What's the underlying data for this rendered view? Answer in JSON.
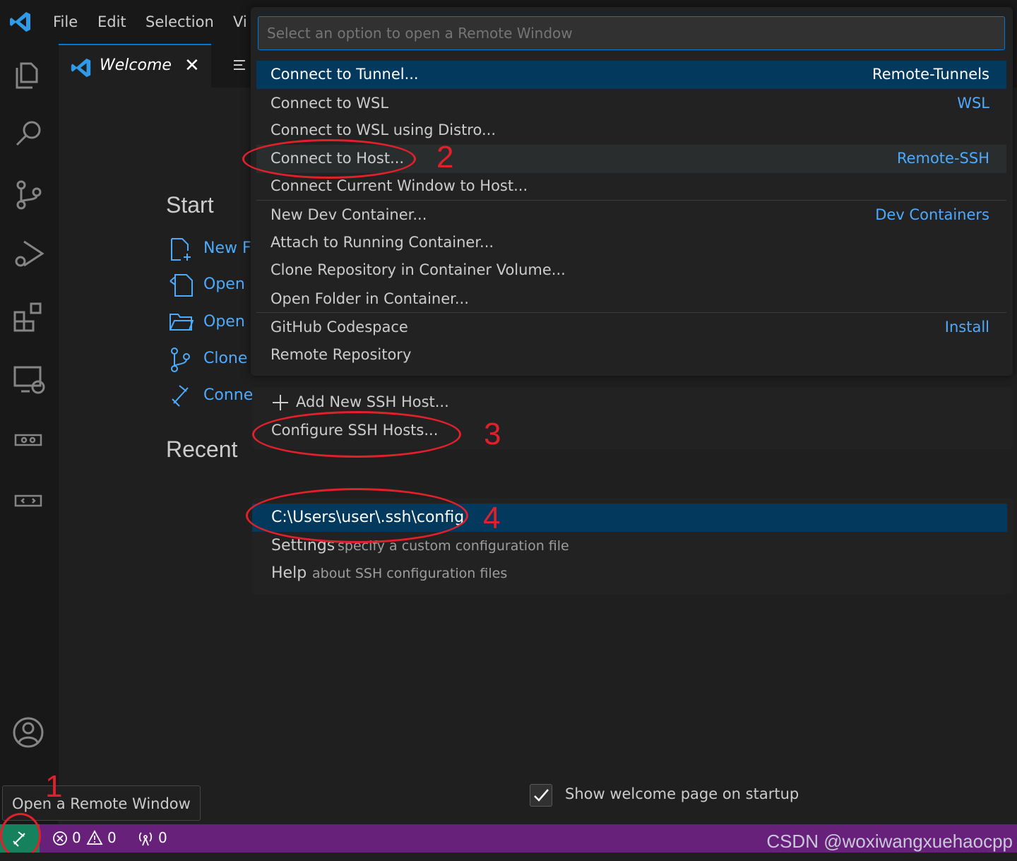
{
  "menu": {
    "file": "File",
    "edit": "Edit",
    "selection": "Selection",
    "view_partial": "Vi"
  },
  "tab": {
    "welcome": "Welcome",
    "close": "✕"
  },
  "welcome": {
    "start_heading": "Start",
    "items": [
      {
        "label": "New F",
        "icon": "new-file-icon"
      },
      {
        "label": "Open",
        "icon": "open-file-icon"
      },
      {
        "label": "Open",
        "icon": "open-folder-icon"
      },
      {
        "label": "Clone",
        "icon": "source-control-icon"
      },
      {
        "label": "Conne",
        "icon": "remote-connect-icon"
      }
    ],
    "recent_heading": "Recent",
    "show_on_startup": "Show welcome page on startup",
    "show_on_startup_checked": true
  },
  "quickpick": {
    "placeholder": "Select an option to open a Remote Window",
    "options": [
      {
        "label": "Connect to Tunnel...",
        "group": "Remote-Tunnels"
      },
      {
        "label": "Connect to WSL",
        "group": "WSL"
      },
      {
        "label": "Connect to WSL using Distro...",
        "group": ""
      },
      {
        "label": "Connect to Host...",
        "group": "Remote-SSH"
      },
      {
        "label": "Connect Current Window to Host...",
        "group": ""
      },
      {
        "label": "New Dev Container...",
        "group": "Dev Containers"
      },
      {
        "label": "Attach to Running Container...",
        "group": ""
      },
      {
        "label": "Clone Repository in Container Volume...",
        "group": ""
      },
      {
        "label": "Open Folder in Container...",
        "group": ""
      },
      {
        "label": "GitHub Codespace",
        "group": "Install"
      },
      {
        "label": "Remote Repository",
        "group": ""
      }
    ]
  },
  "ssh_pick": {
    "add": "Add New SSH Host...",
    "configure": "Configure SSH Hosts..."
  },
  "config_pick": {
    "items": [
      {
        "label": "C:\\Users\\user\\.ssh\\config",
        "desc": ""
      },
      {
        "label": "Settings",
        "desc": "specify a custom configuration file"
      },
      {
        "label": "Help",
        "desc": "about SSH configuration files"
      }
    ]
  },
  "annotations": [
    "1",
    "2",
    "3",
    "4"
  ],
  "tooltip": "Open a Remote Window",
  "statusbar": {
    "errors": "0",
    "warnings": "0",
    "ports": "0"
  },
  "watermark": "CSDN @woxiwangxuehaocpp",
  "colors": {
    "accent": "#0078d4",
    "link": "#4daafc",
    "statusbar": "#68217a",
    "remote": "#16825d",
    "annotation": "#e0202a"
  }
}
